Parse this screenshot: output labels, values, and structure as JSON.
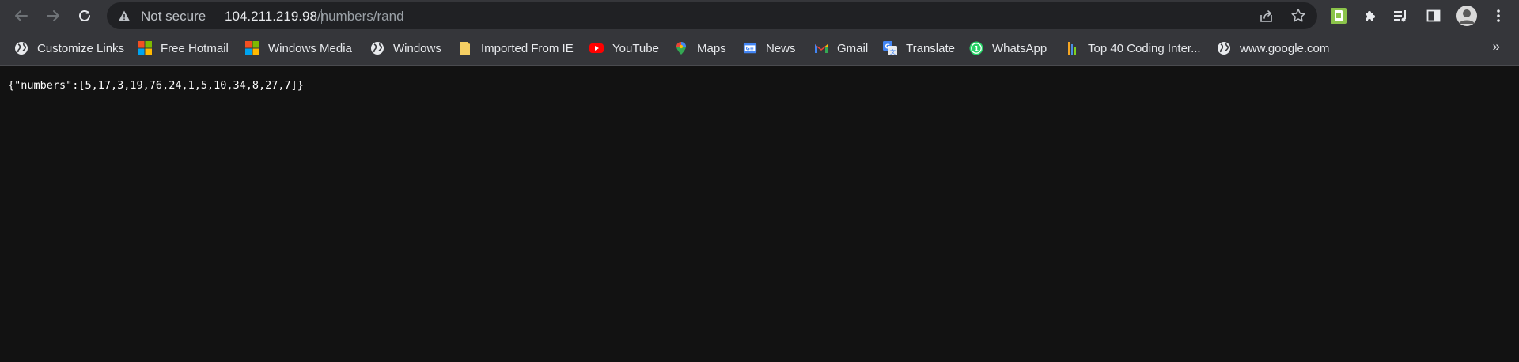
{
  "browser": {
    "address_bar": {
      "security_label": "Not secure",
      "url_host": "104.211.219.98",
      "url_path": "/numbers/rand"
    },
    "icons": {
      "back": "back-arrow-icon",
      "forward": "forward-arrow-icon",
      "reload": "reload-icon",
      "warning": "warning-icon",
      "share": "share-icon",
      "bookmark_star": "star-icon",
      "extension_green": "extension-icon",
      "extensions": "puzzle-icon",
      "media": "media-queue-icon",
      "side_panel": "side-panel-icon",
      "profile": "profile-avatar",
      "menu": "more-vert-icon"
    }
  },
  "bookmarks": [
    {
      "label": "Customize Links",
      "icon": "globe-icon"
    },
    {
      "label": "Free Hotmail",
      "icon": "windows-logo-icon"
    },
    {
      "label": "Windows Media",
      "icon": "windows-logo-icon"
    },
    {
      "label": "Windows",
      "icon": "globe-icon"
    },
    {
      "label": "Imported From IE",
      "icon": "folder-icon"
    },
    {
      "label": "YouTube",
      "icon": "youtube-icon"
    },
    {
      "label": "Maps",
      "icon": "maps-pin-icon"
    },
    {
      "label": "News",
      "icon": "news-icon"
    },
    {
      "label": "Gmail",
      "icon": "gmail-icon"
    },
    {
      "label": "Translate",
      "icon": "translate-icon"
    },
    {
      "label": "WhatsApp",
      "icon": "whatsapp-icon"
    },
    {
      "label": "Top 40 Coding Inter...",
      "icon": "bars-icon"
    },
    {
      "label": "www.google.com",
      "icon": "globe-icon"
    }
  ],
  "bookmarks_overflow": "»",
  "page": {
    "body_text": "{\"numbers\":[5,17,3,19,76,24,1,5,10,34,8,27,7]}"
  },
  "colors": {
    "toolbar": "#35363a",
    "omnibox": "#202124",
    "page_background": "#121212",
    "accent_green": "#8bc34a"
  }
}
